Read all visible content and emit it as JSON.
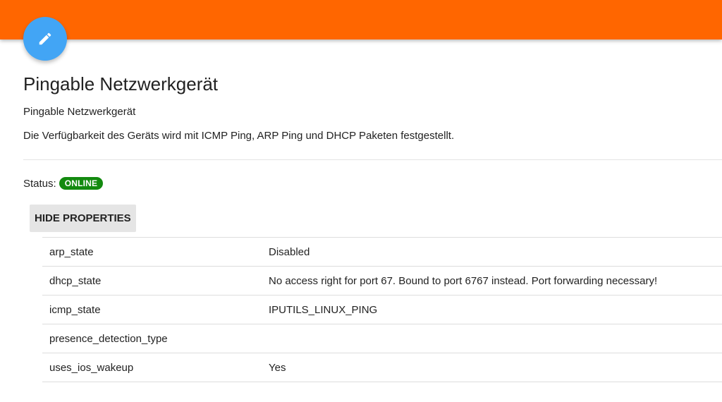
{
  "header": {
    "accent_color": "#ff6600",
    "edit_icon": "pencil-icon",
    "fab_color": "#42a5f5"
  },
  "device": {
    "title": "Pingable Netzwerkgerät",
    "subtitle": "Pingable Netzwerkgerät",
    "description": "Die Verfügbarkeit des Geräts wird mit ICMP Ping, ARP Ping und DHCP Paketen festgestellt."
  },
  "status": {
    "label": "Status:",
    "value": "ONLINE",
    "color": "#138a0f"
  },
  "properties": {
    "toggle_label": "HIDE PROPERTIES",
    "rows": [
      {
        "key": "arp_state",
        "value": "Disabled"
      },
      {
        "key": "dhcp_state",
        "value": "No access right for port 67. Bound to port 6767 instead. Port forwarding necessary!"
      },
      {
        "key": "icmp_state",
        "value": "IPUTILS_LINUX_PING"
      },
      {
        "key": "presence_detection_type",
        "value": ""
      },
      {
        "key": "uses_ios_wakeup",
        "value": "Yes"
      }
    ]
  }
}
